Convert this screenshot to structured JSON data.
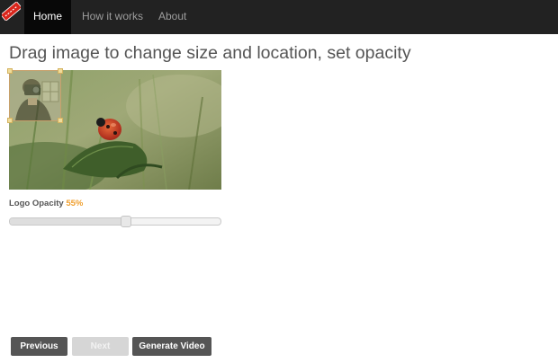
{
  "navbar": {
    "brand_icon": "ribbon-logo-icon",
    "items": [
      {
        "label": "Home",
        "active": true
      },
      {
        "label": "How it works",
        "active": false
      },
      {
        "label": "About",
        "active": false
      }
    ]
  },
  "main": {
    "heading": "Drag image to change size and location, set opacity",
    "preview": {
      "background": "ladybug-on-leaf-photo",
      "logo_overlay": "camera-person-photo"
    },
    "opacity": {
      "label": "Logo Opacity",
      "value_text": "55%",
      "value": 0.55
    }
  },
  "actions": {
    "previous_label": "Previous",
    "next_label": "Next",
    "generate_label": "Generate Video"
  },
  "colors": {
    "navbar_bg": "#222222",
    "accent": "#f0a030",
    "button_dark": "#555555",
    "button_disabled": "#d6d6d6"
  }
}
